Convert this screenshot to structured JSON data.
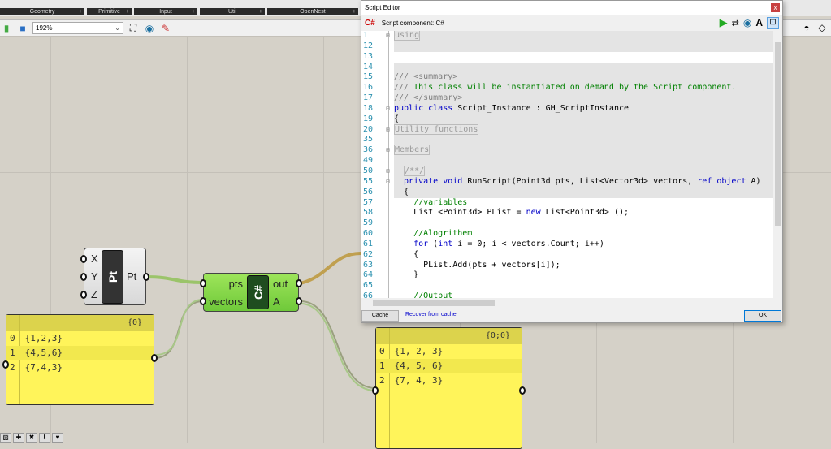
{
  "ribbon": {
    "tabs": [
      "Geometry",
      "Primitive",
      "Input",
      "Util",
      "OpenNest"
    ]
  },
  "toolbar": {
    "zoom": "192%"
  },
  "editor": {
    "title": "Script Editor",
    "close": "x",
    "component_label": "Script component: C#",
    "logo": "C#",
    "cache_button": "Cache",
    "recover_link": "Recover from cache",
    "ok_button": "OK",
    "lines": [
      {
        "n": "1",
        "fold": "⊞",
        "hl": true,
        "seg": [
          [
            "using",
            "c-fold"
          ]
        ]
      },
      {
        "n": "12",
        "hl": true,
        "seg": []
      },
      {
        "n": "13",
        "hl": false,
        "seg": []
      },
      {
        "n": "14",
        "hl": true,
        "seg": []
      },
      {
        "n": "15",
        "hl": true,
        "seg": [
          [
            "/// <summary>",
            "c-cg"
          ]
        ]
      },
      {
        "n": "16",
        "hl": true,
        "seg": [
          [
            "/// ",
            "c-cg"
          ],
          [
            "This class will be instantiated on demand by the Script component.",
            "c-cm"
          ]
        ]
      },
      {
        "n": "17",
        "hl": true,
        "seg": [
          [
            "/// </summary>",
            "c-cg"
          ]
        ]
      },
      {
        "n": "18",
        "fold": "⊟",
        "hl": true,
        "seg": [
          [
            "public class ",
            "c-kw"
          ],
          [
            "Script_Instance : GH_ScriptInstance",
            "c-pl"
          ]
        ]
      },
      {
        "n": "19",
        "hl": true,
        "seg": [
          [
            "{",
            "c-pl"
          ]
        ]
      },
      {
        "n": "20",
        "fold": "⊞",
        "hl": true,
        "seg": [
          [
            "Utility functions",
            "c-fold"
          ]
        ]
      },
      {
        "n": "35",
        "hl": true,
        "seg": []
      },
      {
        "n": "36",
        "fold": "⊞",
        "hl": true,
        "seg": [
          [
            "Members",
            "c-fold"
          ]
        ]
      },
      {
        "n": "49",
        "hl": true,
        "seg": []
      },
      {
        "n": "50",
        "fold": "⊞",
        "hl": true,
        "seg": [
          [
            "  "
          ],
          [
            "/**/",
            "c-fold"
          ]
        ]
      },
      {
        "n": "55",
        "fold": "⊟",
        "hl": true,
        "seg": [
          [
            "  private void ",
            "c-kw"
          ],
          [
            "RunScript(Point3d pts, List<Vector3d> vectors, ",
            "c-pl"
          ],
          [
            "ref object ",
            "c-kw"
          ],
          [
            "A)",
            "c-pl"
          ]
        ]
      },
      {
        "n": "56",
        "hl": true,
        "seg": [
          [
            "  {",
            "c-pl"
          ]
        ]
      },
      {
        "n": "57",
        "hl": false,
        "seg": [
          [
            "    //variables",
            "c-cm"
          ]
        ]
      },
      {
        "n": "58",
        "hl": false,
        "seg": [
          [
            "    List <Point3d> PList = ",
            "c-pl"
          ],
          [
            "new ",
            "c-kw"
          ],
          [
            "List<Point3d> ();",
            "c-pl"
          ]
        ]
      },
      {
        "n": "59",
        "hl": false,
        "seg": []
      },
      {
        "n": "60",
        "hl": false,
        "seg": [
          [
            "    //Alogrithem",
            "c-cm"
          ]
        ]
      },
      {
        "n": "61",
        "hl": false,
        "seg": [
          [
            "    for ",
            "c-kw"
          ],
          [
            "(",
            "c-pl"
          ],
          [
            "int ",
            "c-kw"
          ],
          [
            "i = 0; i < vectors.Count; i++)",
            "c-pl"
          ]
        ]
      },
      {
        "n": "62",
        "hl": false,
        "seg": [
          [
            "    {",
            "c-pl"
          ]
        ]
      },
      {
        "n": "63",
        "hl": false,
        "seg": [
          [
            "      PList.Add(pts + vectors[i]);",
            "c-pl"
          ]
        ]
      },
      {
        "n": "64",
        "hl": false,
        "seg": [
          [
            "    }",
            "c-pl"
          ]
        ]
      },
      {
        "n": "65",
        "hl": false,
        "seg": []
      },
      {
        "n": "66",
        "hl": false,
        "seg": [
          [
            "    //Output",
            "c-cm"
          ]
        ]
      }
    ]
  },
  "pt_component": {
    "inputs": [
      "X",
      "Y",
      "Z"
    ],
    "name": "Pt",
    "output": "Pt"
  },
  "cs_component": {
    "inputs": [
      "pts",
      "vectors"
    ],
    "name": "C#",
    "outputs": [
      "out",
      "A"
    ]
  },
  "panel_left": {
    "path": "{0}",
    "rows": [
      {
        "i": "0",
        "v": "{1,2,3}"
      },
      {
        "i": "1",
        "v": "{4,5,6}"
      },
      {
        "i": "2",
        "v": "{7,4,3}"
      }
    ]
  },
  "panel_right": {
    "path": "{0;0}",
    "rows": [
      {
        "i": "0",
        "v": "{1, 2, 3}"
      },
      {
        "i": "1",
        "v": "{4, 5, 6}"
      },
      {
        "i": "2",
        "v": "{7, 4, 3}"
      }
    ]
  },
  "colors": {
    "component_green": "#8bd84c",
    "panel_yellow": "#fff45a",
    "wire_green": "#8fbf5a",
    "wire_orange": "#e07b3a"
  }
}
